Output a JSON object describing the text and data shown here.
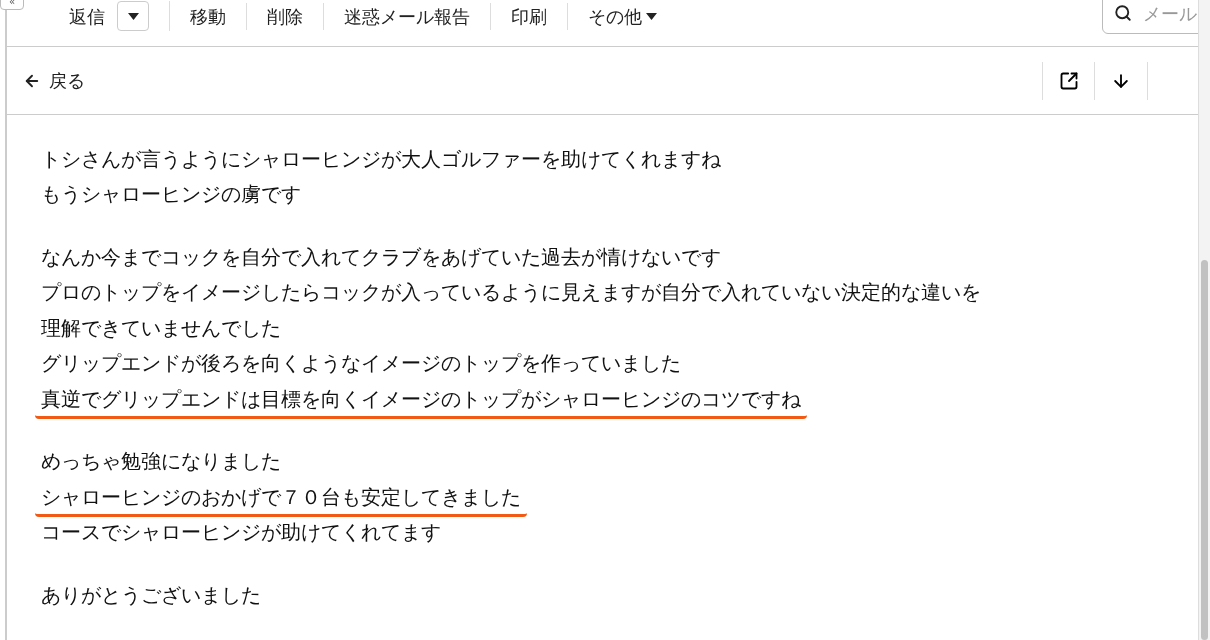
{
  "collapse_button": {
    "label": "«"
  },
  "toolbar": {
    "items": [
      {
        "kind": "split",
        "label": "返信"
      },
      {
        "kind": "plain",
        "label": "移動"
      },
      {
        "kind": "plain",
        "label": "削除"
      },
      {
        "kind": "plain",
        "label": "迷惑メール報告"
      },
      {
        "kind": "plain",
        "label": "印刷"
      },
      {
        "kind": "menu",
        "label": "その他"
      }
    ],
    "search": {
      "placeholder": "メール"
    }
  },
  "header": {
    "back_label": "戻る"
  },
  "message": {
    "paragraphs": [
      {
        "lines": [
          {
            "text": "トシさんが言うようにシャローヒンジが大人ゴルファーを助けてくれますね",
            "underlined": false
          },
          {
            "text": "もうシャローヒンジの虜です",
            "underlined": false
          }
        ]
      },
      {
        "lines": [
          {
            "text": "なんか今までコックを自分で入れてクラブをあげていた過去が情けないです",
            "underlined": false
          },
          {
            "text": "プロのトップをイメージしたらコックが入っているように見えますが自分で入れていない決定的な違いを",
            "underlined": false
          },
          {
            "text": "理解できていませんでした",
            "underlined": false
          },
          {
            "text": "グリップエンドが後ろを向くようなイメージのトップを作っていました",
            "underlined": false
          },
          {
            "text": "真逆でグリップエンドは目標を向くイメージのトップがシャローヒンジのコツですね",
            "underlined": true
          }
        ]
      },
      {
        "lines": [
          {
            "text": "めっちゃ勉強になりました",
            "underlined": false
          },
          {
            "text": "シャローヒンジのおかげで７０台も安定してきました",
            "underlined": true
          },
          {
            "text": "コースでシャローヒンジが助けてくれてます",
            "underlined": false
          }
        ]
      },
      {
        "lines": [
          {
            "text": "ありがとうございました",
            "underlined": false
          }
        ]
      }
    ]
  }
}
